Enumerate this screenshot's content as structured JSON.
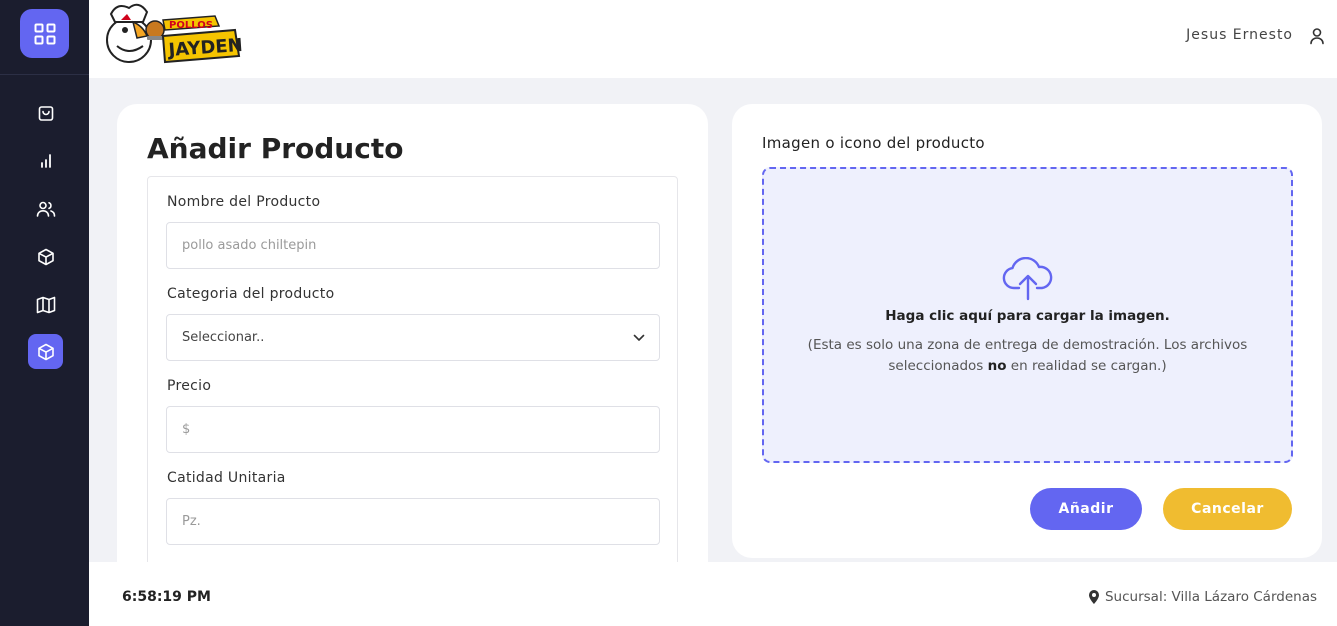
{
  "header": {
    "brand_top": "POLLOS",
    "brand_bottom": "JAYDEN",
    "user_name": "Jesus Ernesto"
  },
  "sidebar": {
    "items": [
      {
        "icon": "shopping-bag-icon"
      },
      {
        "icon": "bar-chart-icon"
      },
      {
        "icon": "users-icon"
      },
      {
        "icon": "box-icon"
      },
      {
        "icon": "map-icon"
      },
      {
        "icon": "box-icon",
        "active": true
      }
    ]
  },
  "form": {
    "title": "Añadir Producto",
    "name_label": "Nombre del Producto",
    "name_placeholder": "pollo asado chiltepin",
    "category_label": "Categoria del producto",
    "category_selected": "Seleccionar..",
    "price_label": "Precio",
    "price_placeholder": "$",
    "qty_label": "Catidad Unitaria",
    "qty_placeholder": "Pz."
  },
  "upload": {
    "label": "Imagen o icono del producto",
    "main_text": "Haga clic aquí para cargar la imagen.",
    "sub_before": "(Esta es solo una zona de entrega de demostración. Los archivos seleccionados ",
    "sub_bold": "no",
    "sub_after": " en realidad se cargan.)"
  },
  "buttons": {
    "add": "Añadir",
    "cancel": "Cancelar"
  },
  "footer": {
    "time": "6:58:19 PM",
    "branch": "Sucursal: Villa Lázaro Cárdenas"
  },
  "colors": {
    "accent": "#6366f1",
    "sidebar_bg": "#1b1d2e",
    "cancel": "#f0bc30"
  }
}
